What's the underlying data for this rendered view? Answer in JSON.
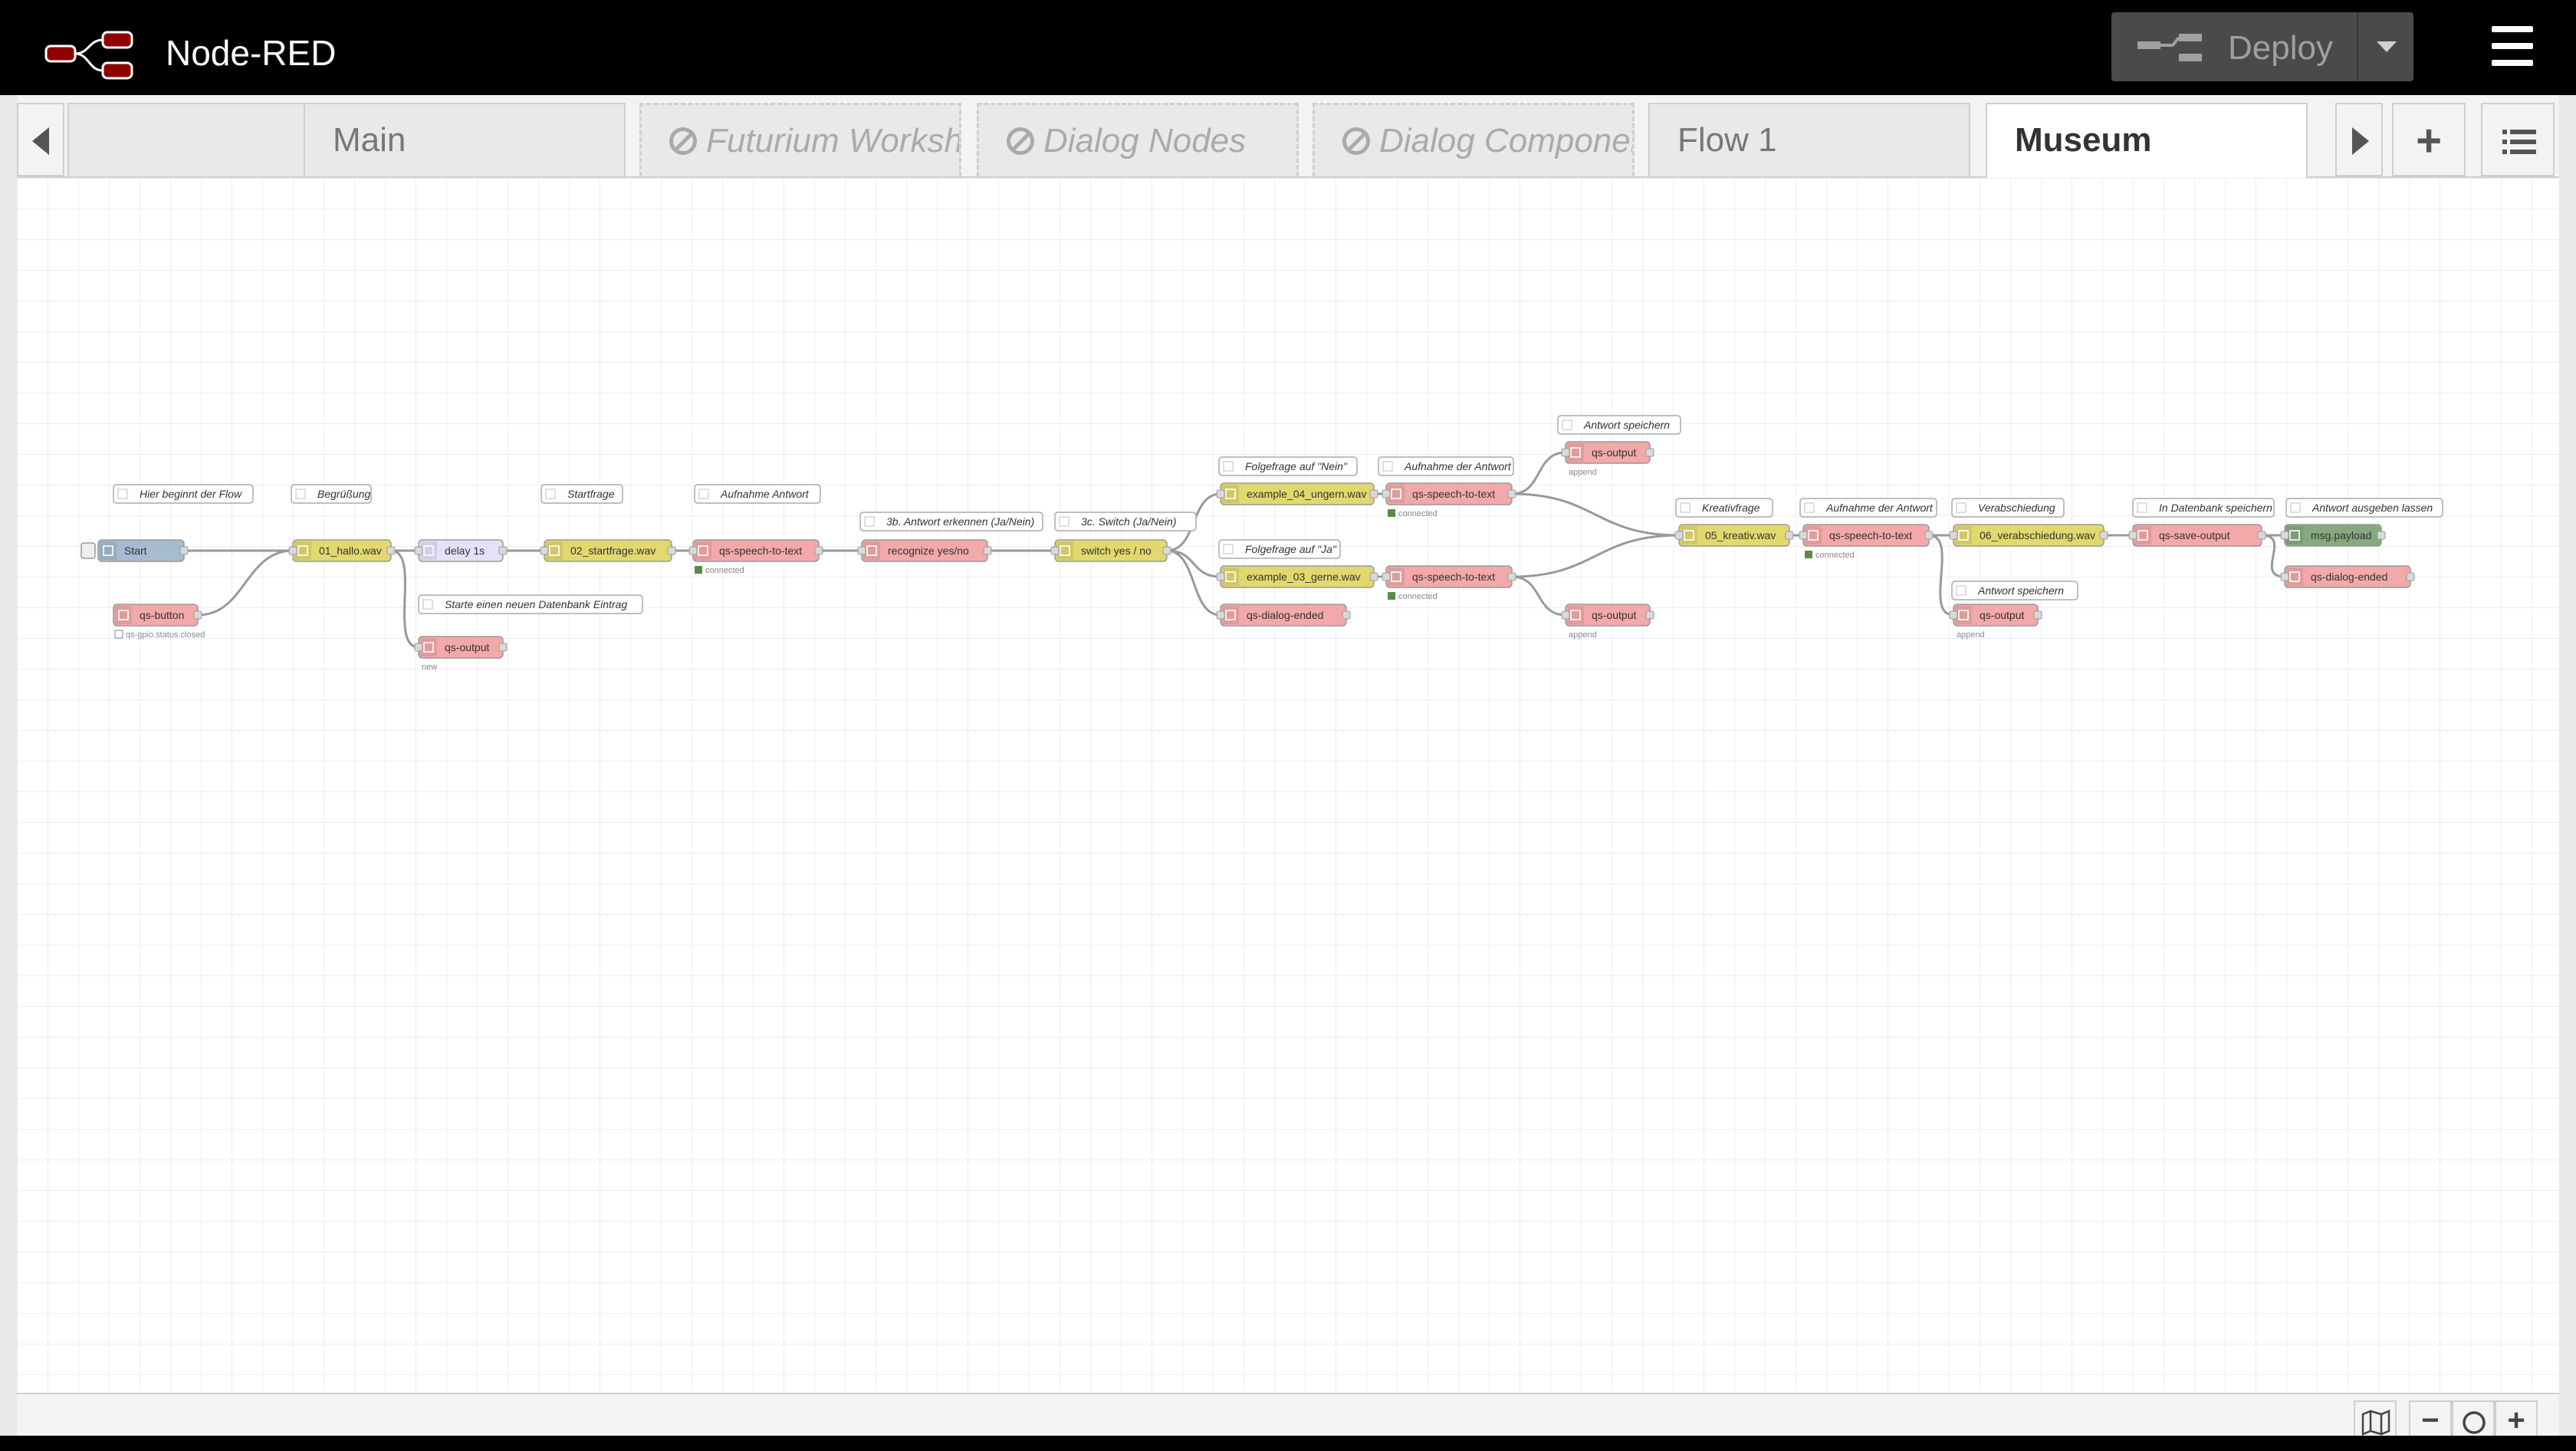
{
  "app": {
    "title": "Node-RED"
  },
  "deploy": {
    "label": "Deploy"
  },
  "tabs": [
    {
      "label": "",
      "disabled": false,
      "active": false
    },
    {
      "label": "Main",
      "disabled": false,
      "active": false
    },
    {
      "label": "Futurium Workshc",
      "disabled": true,
      "active": false
    },
    {
      "label": "Dialog Nodes",
      "disabled": true,
      "active": false
    },
    {
      "label": "Dialog Componer",
      "disabled": true,
      "active": false
    },
    {
      "label": "Flow 1",
      "disabled": false,
      "active": false
    },
    {
      "label": "Museum",
      "disabled": false,
      "active": true
    }
  ],
  "colors": {
    "header_bg": "#000000",
    "inject": "#a6bbcf",
    "audio": "#e2d96e",
    "delay": "#e6e0f8",
    "qs": "#f3a9a9",
    "switch": "#e2d96e",
    "debug": "#87a980",
    "comment": "#ffffff",
    "status_green": "#5a8a4a"
  },
  "flow": {
    "comments": [
      {
        "text": "Hier beginnt der Flow"
      },
      {
        "text": "Begrüßung"
      },
      {
        "text": "Startfrage"
      },
      {
        "text": "Aufnahme Antwort"
      },
      {
        "text": "3b. Antwort erkennen (Ja/Nein)"
      },
      {
        "text": "3c. Switch (Ja/Nein)"
      },
      {
        "text": "Folgefrage auf \"Nein\""
      },
      {
        "text": "Aufnahme der Antwort"
      },
      {
        "text": "Antwort speichern"
      },
      {
        "text": "Folgefrage auf \"Ja\""
      },
      {
        "text": "Starte einen neuen Datenbank Eintrag"
      },
      {
        "text": "Kreativfrage"
      },
      {
        "text": "Aufnahme der Antwort"
      },
      {
        "text": "Verabschiedung"
      },
      {
        "text": "In Datenbank speichern"
      },
      {
        "text": "Antwort ausgeben lassen"
      },
      {
        "text": "Antwort speichern"
      }
    ],
    "nodes": [
      {
        "label": "Start",
        "type": "inject",
        "status": ""
      },
      {
        "label": "qs-button",
        "type": "qs",
        "status": "qs-gpio.status.closed"
      },
      {
        "label": "01_hallo.wav",
        "type": "audio",
        "status": ""
      },
      {
        "label": "delay 1s",
        "type": "delay",
        "status": ""
      },
      {
        "label": "qs-output",
        "type": "qs",
        "status": "new"
      },
      {
        "label": "02_startfrage.wav",
        "type": "audio",
        "status": ""
      },
      {
        "label": "qs-speech-to-text",
        "type": "qs",
        "status": "connected"
      },
      {
        "label": "recognize yes/no",
        "type": "qs",
        "status": ""
      },
      {
        "label": "switch yes / no",
        "type": "switch",
        "status": ""
      },
      {
        "label": "example_04_ungern.wav",
        "type": "audio",
        "status": ""
      },
      {
        "label": "example_03_gerne.wav",
        "type": "audio",
        "status": ""
      },
      {
        "label": "qs-dialog-ended",
        "type": "qs",
        "status": ""
      },
      {
        "label": "qs-speech-to-text",
        "type": "qs",
        "status": "connected"
      },
      {
        "label": "qs-speech-to-text",
        "type": "qs",
        "status": "connected"
      },
      {
        "label": "qs-output",
        "type": "qs",
        "status": "append"
      },
      {
        "label": "qs-output",
        "type": "qs",
        "status": "append"
      },
      {
        "label": "05_kreativ.wav",
        "type": "audio",
        "status": ""
      },
      {
        "label": "qs-speech-to-text",
        "type": "qs",
        "status": "connected"
      },
      {
        "label": "06_verabschiedung.wav",
        "type": "audio",
        "status": ""
      },
      {
        "label": "qs-output",
        "type": "qs",
        "status": "append"
      },
      {
        "label": "qs-save-output",
        "type": "qs",
        "status": ""
      },
      {
        "label": "msg.payload",
        "type": "debug",
        "status": ""
      },
      {
        "label": "qs-dialog-ended",
        "type": "qs",
        "status": ""
      }
    ]
  }
}
